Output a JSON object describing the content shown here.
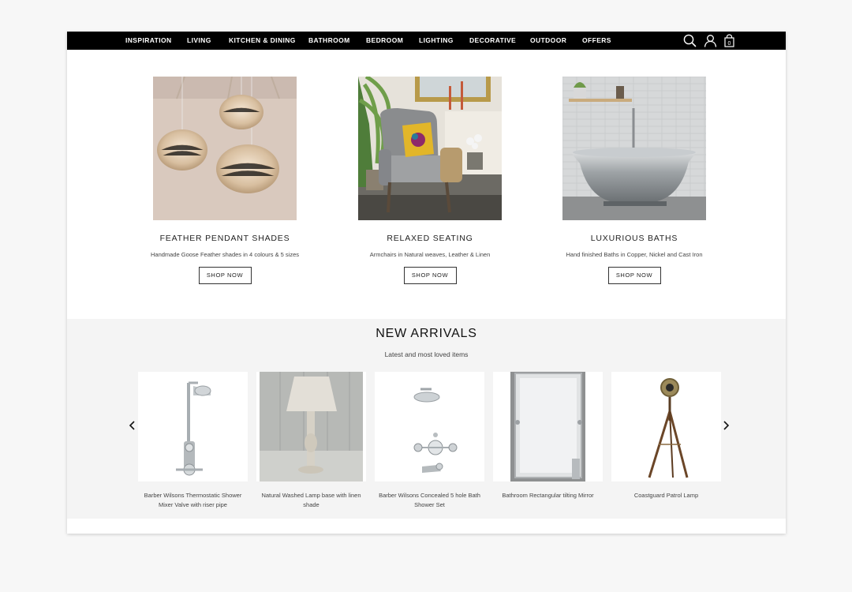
{
  "nav": {
    "items": [
      "INSPIRATION",
      "LIVING",
      "KITCHEN & DINING",
      "BATHROOM",
      "BEDROOM",
      "LIGHTING",
      "DECORATIVE",
      "OUTDOOR",
      "OFFERS"
    ],
    "icons": [
      "search-icon",
      "user-icon",
      "cart-icon"
    ],
    "cart_count": "0"
  },
  "features": [
    {
      "title": "FEATHER PENDANT SHADES",
      "description": "Handmade Goose Feather shades in 4 colours & 5 sizes",
      "button": "SHOP NOW"
    },
    {
      "title": "RELAXED SEATING",
      "description": "Armchairs in Natural weaves, Leather & Linen",
      "button": "SHOP NOW"
    },
    {
      "title": "LUXURIOUS BATHS",
      "description": "Hand finished Baths in Copper, Nickel and Cast Iron",
      "button": "SHOP NOW"
    }
  ],
  "arrivals": {
    "title": "NEW ARRIVALS",
    "subtitle": "Latest and most loved items",
    "products": [
      {
        "name": "Barber Wilsons Thermostatic Shower Mixer Valve with riser pipe"
      },
      {
        "name": "Natural Washed Lamp base with linen shade"
      },
      {
        "name": "Barber Wilsons Concealed 5 hole Bath Shower Set"
      },
      {
        "name": "Bathroom Rectangular tilting Mirror"
      },
      {
        "name": "Coastguard Patrol Lamp"
      }
    ]
  },
  "colors": {
    "nav_background": "#000000",
    "nav_text": "#ffffff",
    "page_background": "#f7f7f7",
    "arrivals_background": "#f4f4f4"
  }
}
